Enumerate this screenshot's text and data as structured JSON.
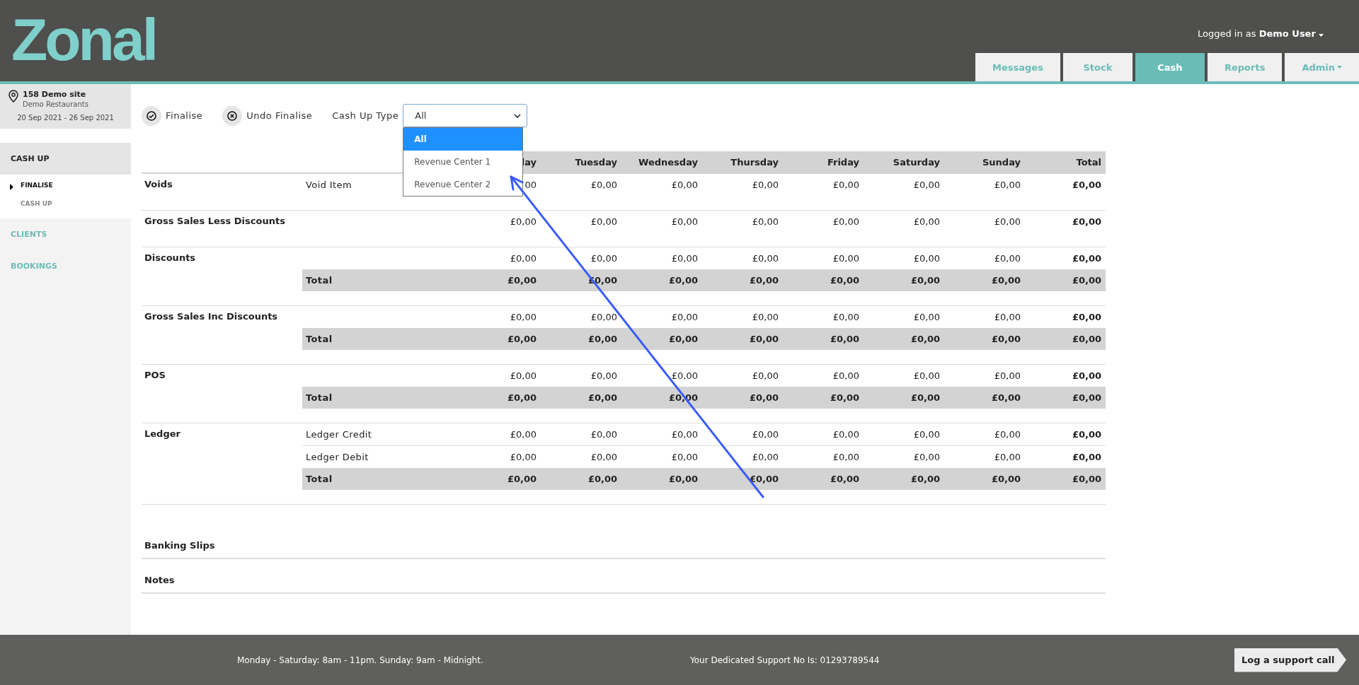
{
  "header": {
    "logo": "Zonal",
    "user_prefix": "Logged in as",
    "user_name": "Demo User",
    "tabs": [
      {
        "label": "Messages",
        "selected": false,
        "menu": false
      },
      {
        "label": "Stock",
        "selected": false,
        "menu": false
      },
      {
        "label": "Cash",
        "selected": true,
        "menu": false
      },
      {
        "label": "Reports",
        "selected": false,
        "menu": false
      },
      {
        "label": "Admin",
        "selected": false,
        "menu": true
      }
    ]
  },
  "sidebar": {
    "site": "158 Demo site",
    "company": "Demo Restaurants",
    "dates": "20 Sep 2021 - 26 Sep 2021",
    "menu": [
      {
        "label": "CASH UP",
        "expanded": true,
        "children": [
          {
            "label": "FINALISE",
            "selected": true
          },
          {
            "label": "CASH UP",
            "selected": false
          }
        ]
      },
      {
        "label": "CLIENTS",
        "expanded": false
      },
      {
        "label": "BOOKINGS",
        "expanded": false
      }
    ]
  },
  "toolbar": {
    "buttons": [
      {
        "label": "Finalise",
        "kind": "check"
      },
      {
        "label": "Undo Finalise",
        "kind": "cross"
      }
    ],
    "cash_up_type": {
      "label": "Cash Up Type",
      "value": "All",
      "options": [
        {
          "label": "All",
          "selected": true
        },
        {
          "label": "Revenue Center 1",
          "selected": false
        },
        {
          "label": "Revenue Center 2",
          "selected": false
        }
      ]
    }
  },
  "table": {
    "columns": [
      "lay",
      "Tuesday",
      "Wednesday",
      "Thursday",
      "Friday",
      "Saturday",
      "Sunday",
      "Total"
    ],
    "sections": [
      {
        "label": "Voids",
        "rows": [
          {
            "kind": "line",
            "name": "Void Item",
            "values": [
              "00",
              "£0,00",
              "£0,00",
              "£0,00",
              "£0,00",
              "£0,00",
              "£0,00",
              "£0,00"
            ]
          }
        ]
      },
      {
        "label": "Gross Sales Less Discounts",
        "rows": [
          {
            "kind": "line",
            "values": [
              "£0,00",
              "£0,00",
              "£0,00",
              "£0,00",
              "£0,00",
              "£0,00",
              "£0,00",
              "£0,00"
            ]
          }
        ]
      },
      {
        "label": "Discounts",
        "rows": [
          {
            "kind": "line",
            "values": [
              "£0,00",
              "£0,00",
              "£0,00",
              "£0,00",
              "£0,00",
              "£0,00",
              "£0,00",
              "£0,00"
            ]
          },
          {
            "kind": "total",
            "name": "Total",
            "values": [
              "£0,00",
              "£0,00",
              "£0,00",
              "£0,00",
              "£0,00",
              "£0,00",
              "£0,00",
              "£0,00"
            ]
          }
        ]
      },
      {
        "label": "Gross Sales Inc Discounts",
        "rows": [
          {
            "kind": "line",
            "values": [
              "£0,00",
              "£0,00",
              "£0,00",
              "£0,00",
              "£0,00",
              "£0,00",
              "£0,00",
              "£0,00"
            ]
          },
          {
            "kind": "total",
            "name": "Total",
            "values": [
              "£0,00",
              "£0,00",
              "£0,00",
              "£0,00",
              "£0,00",
              "£0,00",
              "£0,00",
              "£0,00"
            ]
          }
        ]
      },
      {
        "label": "POS",
        "rows": [
          {
            "kind": "line",
            "values": [
              "£0,00",
              "£0,00",
              "£0,00",
              "£0,00",
              "£0,00",
              "£0,00",
              "£0,00",
              "£0,00"
            ]
          },
          {
            "kind": "total",
            "name": "Total",
            "values": [
              "£0,00",
              "£0,00",
              "£0,00",
              "£0,00",
              "£0,00",
              "£0,00",
              "£0,00",
              "£0,00"
            ]
          }
        ]
      },
      {
        "label": "Ledger",
        "rows": [
          {
            "kind": "line",
            "name": "Ledger Credit",
            "values": [
              "£0,00",
              "£0,00",
              "£0,00",
              "£0,00",
              "£0,00",
              "£0,00",
              "£0,00",
              "£0,00"
            ]
          },
          {
            "kind": "line",
            "name": "Ledger Debit",
            "values": [
              "£0,00",
              "£0,00",
              "£0,00",
              "£0,00",
              "£0,00",
              "£0,00",
              "£0,00",
              "£0,00"
            ]
          },
          {
            "kind": "total",
            "name": "Total",
            "values": [
              "£0,00",
              "£0,00",
              "£0,00",
              "£0,00",
              "£0,00",
              "£0,00",
              "£0,00",
              "£0,00"
            ]
          }
        ]
      }
    ]
  },
  "extra_sections": [
    "Banking Slips",
    "Notes"
  ],
  "footer": {
    "hours": "Monday - Saturday: 8am - 11pm. Sunday: 9am - Midnight.",
    "support": "Your Dedicated Support No Is: 01293789544",
    "button": "Log a support call"
  }
}
